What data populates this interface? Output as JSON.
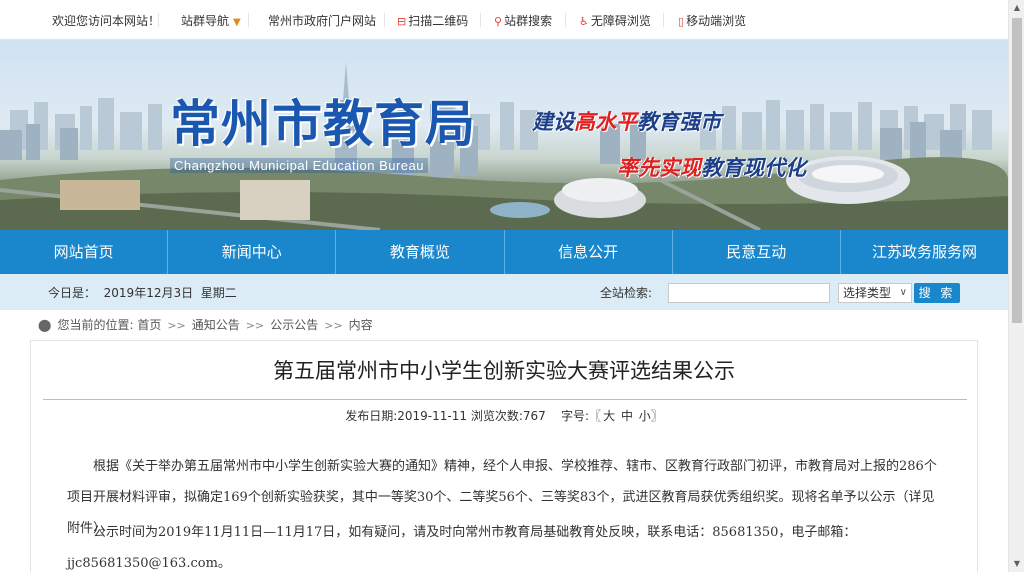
{
  "topbar": {
    "welcome": "欢迎您访问本网站！",
    "site_nav": "站群导航",
    "portal": "常州市政府门户网站",
    "qr": "扫描二维码",
    "site_search": "站群搜索",
    "accessible": "无障碍浏览",
    "mobile": "移动端浏览"
  },
  "banner": {
    "title_cn": "常州市教育局",
    "title_en": "Changzhou Municipal Education Bureau",
    "slogan1_a": "建设",
    "slogan1_hl": "高水平",
    "slogan1_b": "教育强市",
    "slogan2_a": "率先实现",
    "slogan2_b": "教育现代化"
  },
  "nav": {
    "items": [
      "网站首页",
      "新闻中心",
      "教育概览",
      "信息公开",
      "民意互动",
      "江苏政务服务网"
    ]
  },
  "subbar": {
    "date_label": "今日是：",
    "date_value": "2019年12月3日",
    "weekday": "星期二",
    "search_label": "全站检索:",
    "search_value": "",
    "select_value": "选择类型",
    "search_button": "搜 索"
  },
  "breadcrumb": {
    "prefix": "您当前的位置:",
    "items": [
      "首页",
      "通知公告",
      "公示公告",
      "内容"
    ],
    "separator": ">>"
  },
  "article": {
    "title": "第五届常州市中小学生创新实验大赛评选结果公示",
    "publish_label": "发布日期:",
    "publish_date": "2019-11-11",
    "views_label": "浏览次数:",
    "views": "767",
    "fontsize_label": "字号:",
    "fontsize_open": "〖",
    "fontsize_large": "大",
    "fontsize_medium": "中",
    "fontsize_small": "小",
    "fontsize_close": "〗",
    "paragraph1": "根据《关于举办第五届常州市中小学生创新实验大赛的通知》精神，经个人申报、学校推荐、辖市、区教育行政部门初评，市教育局对上报的286个项目开展材料评审，拟确定169个创新实验获奖，其中一等奖30个、二等奖56个、三等奖83个，武进区教育局获优秀组织奖。现将名单予以公示（详见附件）。",
    "paragraph2": "公示时间为2019年11月11日—11月17日，如有疑问，请及时向常州市教育局基础教育处反映，联系电话：85681350，电子邮箱：jjc85681350@163.com。"
  },
  "colors": {
    "nav_blue": "#1a86cc",
    "subbar_bg": "#dcecf7",
    "logo_blue": "#1a57b0",
    "slogan_red": "#e02020",
    "icon_red": "#e0403a"
  }
}
